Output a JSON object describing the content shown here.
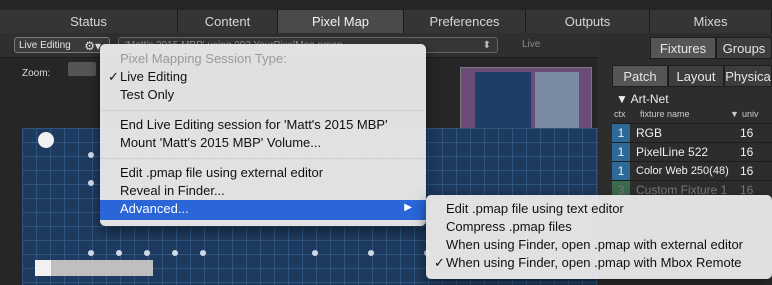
{
  "tabs": [
    "Status",
    "Content",
    "Pixel Map",
    "Preferences",
    "Outputs",
    "Mixes"
  ],
  "active_tab": "Pixel Map",
  "toolbar": {
    "mode_label": "Live Editing",
    "session_label": "'Matt's 2015 MBP' using 002 YourPixelMap.pmap",
    "live_label": "Live",
    "zoom_label": "Zoom:"
  },
  "sidebar": {
    "top_tabs": [
      "Fixtures",
      "Groups"
    ],
    "sub_tabs": [
      "Patch",
      "Layout",
      "Physica"
    ],
    "section": "Art-Net",
    "columns": {
      "ctx": "ctx",
      "name": "fixture name",
      "univ": "univ"
    },
    "rows": [
      {
        "idx": "1",
        "name": "RGB",
        "univ": "16"
      },
      {
        "idx": "1",
        "name": "PixelLine 522",
        "univ": "16"
      },
      {
        "idx": "1",
        "name": "Color Web 250(48)",
        "univ": "16"
      },
      {
        "idx": "3",
        "name": "Custom Fixture 1",
        "univ": "16"
      }
    ]
  },
  "menu": {
    "header": "Pixel Mapping Session Type:",
    "items": [
      {
        "label": "Live Editing",
        "checked": true
      },
      {
        "label": "Test Only",
        "checked": false
      },
      {
        "label": "End Live Editing session for 'Matt's 2015 MBP'"
      },
      {
        "label": "Mount 'Matt's 2015 MBP' Volume..."
      },
      {
        "label": "Edit .pmap file using external editor"
      },
      {
        "label": "Reveal in Finder..."
      },
      {
        "label": "Advanced..."
      }
    ],
    "check_glyph": "✓",
    "arrow_glyph": "▶"
  },
  "submenu": {
    "items": [
      {
        "label": "Edit .pmap file using text editor",
        "checked": false
      },
      {
        "label": "Compress .pmap files",
        "checked": false
      },
      {
        "label": "When using Finder, open .pmap with external editor",
        "checked": false
      },
      {
        "label": "When using Finder, open .pmap with Mbox Remote",
        "checked": true
      }
    ]
  },
  "colors": {
    "highlight": "#2a66d8",
    "grid_blue": "#1e3a5e",
    "index_blue": "#2e6a98"
  }
}
